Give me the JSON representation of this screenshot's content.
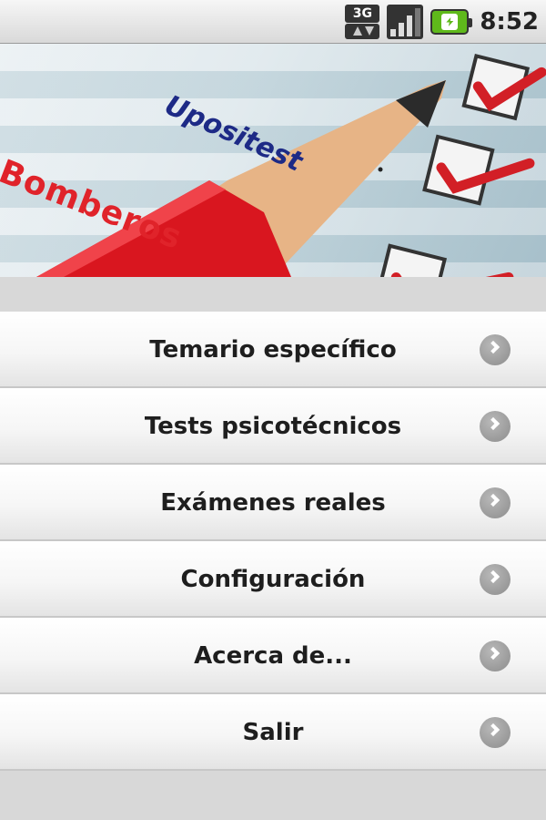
{
  "status_bar": {
    "network": "3G",
    "clock": "8:52",
    "icons": [
      "network-3g-icon",
      "signal-icon",
      "battery-charging-icon"
    ]
  },
  "banner": {
    "title": "Bomberos",
    "logo": "Upositest"
  },
  "menu": {
    "items": [
      {
        "label": "Temario específico",
        "icon": "chevron-right-icon"
      },
      {
        "label": "Tests psicotécnicos",
        "icon": "chevron-right-icon"
      },
      {
        "label": "Exámenes reales",
        "icon": "chevron-right-icon"
      },
      {
        "label": "Configuración",
        "icon": "chevron-right-icon"
      },
      {
        "label": "Acerca de...",
        "icon": "chevron-right-icon"
      },
      {
        "label": "Salir",
        "icon": "chevron-right-icon"
      }
    ]
  },
  "colors": {
    "banner_title": "#e0232a",
    "logo": "#1d2a86",
    "battery": "#5fb91b"
  }
}
